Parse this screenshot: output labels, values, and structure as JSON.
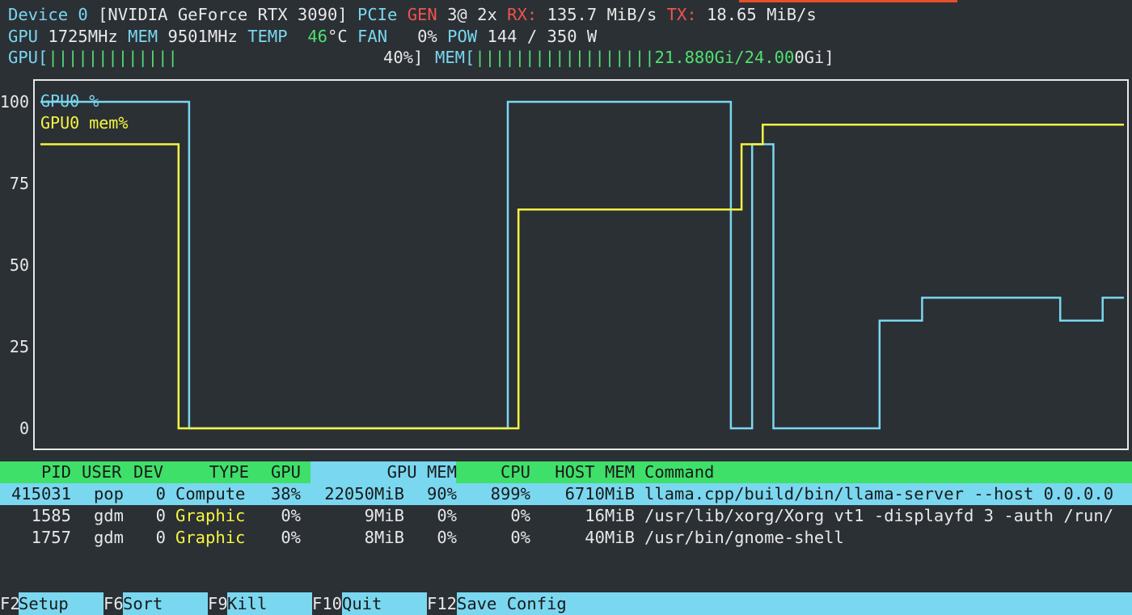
{
  "header": {
    "device_label": "Device 0",
    "device_name": "[NVIDIA GeForce RTX 3090]",
    "pcie_label": "PCIe",
    "gen_label": "GEN",
    "gen_value": "3@ 2x",
    "rx_label": "RX:",
    "rx_value": "135.7 MiB/s",
    "tx_label": "TX:",
    "tx_value": "18.65 MiB/s",
    "gpu_clock_label": "GPU",
    "gpu_clock_value": "1725MHz",
    "mem_clock_label": "MEM",
    "mem_clock_value": "9501MHz",
    "temp_label": "TEMP",
    "temp_value": "46",
    "temp_unit": "°C",
    "fan_label": "FAN",
    "fan_value": "0%",
    "pow_label": "POW",
    "pow_value": "144 / 350 W",
    "gpu_bar_label": "GPU[",
    "gpu_bar_fill": "|||||||||||||",
    "gpu_bar_value": "40%]",
    "gpu_util_fraction": 0.4,
    "mem_bar_label": "MEM[",
    "mem_bar_fill": "||||||||||||||||||",
    "mem_bar_value_used": "21.880Gi/24.00",
    "mem_bar_value_rest": "0Gi]"
  },
  "chart_data": {
    "type": "line",
    "y_ticks": [
      "100",
      "75",
      "50",
      "25",
      "0"
    ],
    "ylim": [
      0,
      100
    ],
    "series": [
      {
        "name": "GPU0 %",
        "color": "#7ad7f0",
        "points": [
          [
            0,
            100
          ],
          [
            14,
            100
          ],
          [
            14,
            0
          ],
          [
            44,
            0
          ],
          [
            44,
            100
          ],
          [
            65,
            100
          ],
          [
            65,
            0
          ],
          [
            67,
            0
          ],
          [
            67,
            87
          ],
          [
            69,
            87
          ],
          [
            69,
            0
          ],
          [
            79,
            0
          ],
          [
            79,
            33
          ],
          [
            83,
            33
          ],
          [
            83,
            40
          ],
          [
            96,
            40
          ],
          [
            96,
            33
          ],
          [
            100,
            33
          ],
          [
            100,
            40
          ],
          [
            102,
            40
          ]
        ]
      },
      {
        "name": "GPU0 mem%",
        "color": "#f5f542",
        "points": [
          [
            0,
            87
          ],
          [
            13,
            87
          ],
          [
            13,
            0
          ],
          [
            45,
            0
          ],
          [
            45,
            67
          ],
          [
            66,
            67
          ],
          [
            66,
            87
          ],
          [
            68,
            87
          ],
          [
            68,
            93
          ],
          [
            102,
            93
          ]
        ]
      }
    ]
  },
  "process_table": {
    "columns": {
      "pid": "PID",
      "user": "USER",
      "dev": "DEV",
      "type": "TYPE",
      "gpu": "GPU",
      "gpu_mem": "GPU MEM",
      "cpu": "CPU",
      "host_mem": "HOST MEM",
      "command": "Command"
    },
    "rows": [
      {
        "pid": "415031",
        "user": "pop",
        "dev": "0",
        "type": "Compute",
        "gpu": "38%",
        "gpu_mem_mib": "22050MiB",
        "gpu_mem_pct": "90%",
        "cpu": "899%",
        "host_mem": "6710MiB",
        "command": "llama.cpp/build/bin/llama-server --host 0.0.0.0"
      },
      {
        "pid": "1585",
        "user": "gdm",
        "dev": "0",
        "type": "Graphic",
        "gpu": "0%",
        "gpu_mem_mib": "9MiB",
        "gpu_mem_pct": "0%",
        "cpu": "0%",
        "host_mem": "16MiB",
        "command": "/usr/lib/xorg/Xorg vt1 -displayfd 3 -auth /run/"
      },
      {
        "pid": "1757",
        "user": "gdm",
        "dev": "0",
        "type": "Graphic",
        "gpu": "0%",
        "gpu_mem_mib": "8MiB",
        "gpu_mem_pct": "0%",
        "cpu": "0%",
        "host_mem": "40MiB",
        "command": "/usr/bin/gnome-shell"
      }
    ]
  },
  "footer": {
    "f2_key": "F2",
    "f2_label": "Setup",
    "f6_key": "F6",
    "f6_label": "Sort",
    "f9_key": "F9",
    "f9_label": "Kill",
    "f10_key": "F10",
    "f10_label": "Quit",
    "f12_key": "F12",
    "f12_label": "Save Config"
  },
  "colors": {
    "background": "#2b3035",
    "cyan": "#7ad7f0",
    "yellow": "#f5f542",
    "green": "#50e070",
    "red": "#ef5350",
    "header_green": "#3ee06a",
    "selected_row": "#7ad7f0"
  }
}
